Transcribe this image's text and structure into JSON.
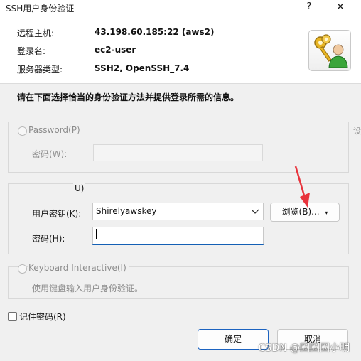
{
  "window": {
    "title": "SSH用户身份验证",
    "help_label": "?",
    "close_label": "✕"
  },
  "info": {
    "host_label": "远程主机:",
    "host_value": "43.198.60.185:22 (aws2)",
    "user_label": "登录名:",
    "user_value": "ec2-user",
    "server_type_label": "服务器类型:",
    "server_type_value": "SSH2, OpenSSH_7.4"
  },
  "instruction": "请在下面选择恰当的身份验证方法并提供登录所需的信息。",
  "password_group": {
    "radio_label": "Password(P)",
    "password_label": "密码(W):",
    "password_value": ""
  },
  "publickey_group": {
    "radio_label": "U)",
    "key_label": "用户密钥(K):",
    "key_value": "Shirelyawskey",
    "browse_label": "浏览(B)...",
    "passphrase_label": "密码(H):",
    "passphrase_value": ""
  },
  "keyboard_group": {
    "radio_label": "Keyboard Interactive(I)",
    "description": "使用键盘输入用户身份验证。"
  },
  "remember_label": "记住密码(R)",
  "buttons": {
    "ok": "确定",
    "cancel": "取消"
  },
  "watermark": "CSDN @圈圈圈小明",
  "edge_text": "设",
  "colors": {
    "accent": "#1c63c0",
    "annotation_arrow": "#e8333c"
  }
}
